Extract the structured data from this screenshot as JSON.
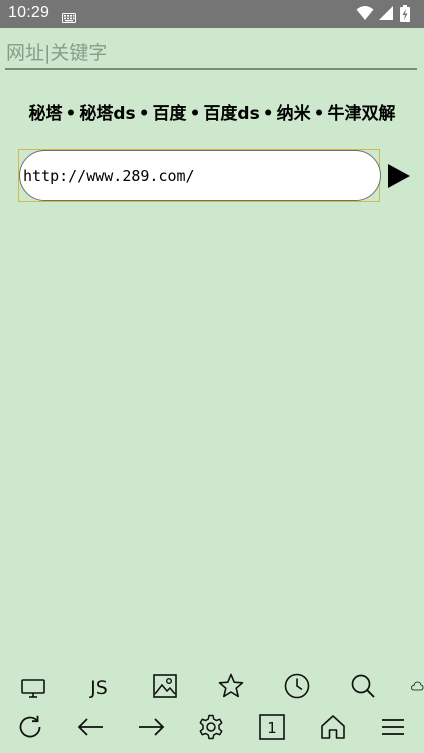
{
  "status_bar": {
    "time": "10:29",
    "icons": [
      "keyboard-icon",
      "wifi-icon",
      "signal-icon",
      "battery-icon"
    ]
  },
  "url_field": {
    "placeholder": "网址|关键字",
    "value": ""
  },
  "quick_links": [
    "秘塔",
    "秘塔ds",
    "百度",
    "百度ds",
    "纳米",
    "牛津双解"
  ],
  "quick_link_separator": "•",
  "current_url": "http://www.289.com/",
  "toolbar_row1": [
    {
      "icon": "desktop-icon"
    },
    {
      "label": "JS"
    },
    {
      "icon": "image-icon"
    },
    {
      "icon": "star-icon"
    },
    {
      "icon": "clock-icon"
    },
    {
      "icon": "search-icon"
    },
    {
      "icon": "cloud-icon"
    }
  ],
  "toolbar_row2": [
    {
      "icon": "refresh-icon"
    },
    {
      "icon": "back-arrow-icon"
    },
    {
      "icon": "forward-arrow-icon"
    },
    {
      "icon": "settings-icon"
    },
    {
      "icon": "tab-count-icon",
      "value": "1"
    },
    {
      "icon": "home-icon"
    },
    {
      "icon": "menu-icon"
    }
  ],
  "colors": {
    "background": "#cde8cd",
    "status_bar": "#757575",
    "url_border": "#d4b84a"
  }
}
